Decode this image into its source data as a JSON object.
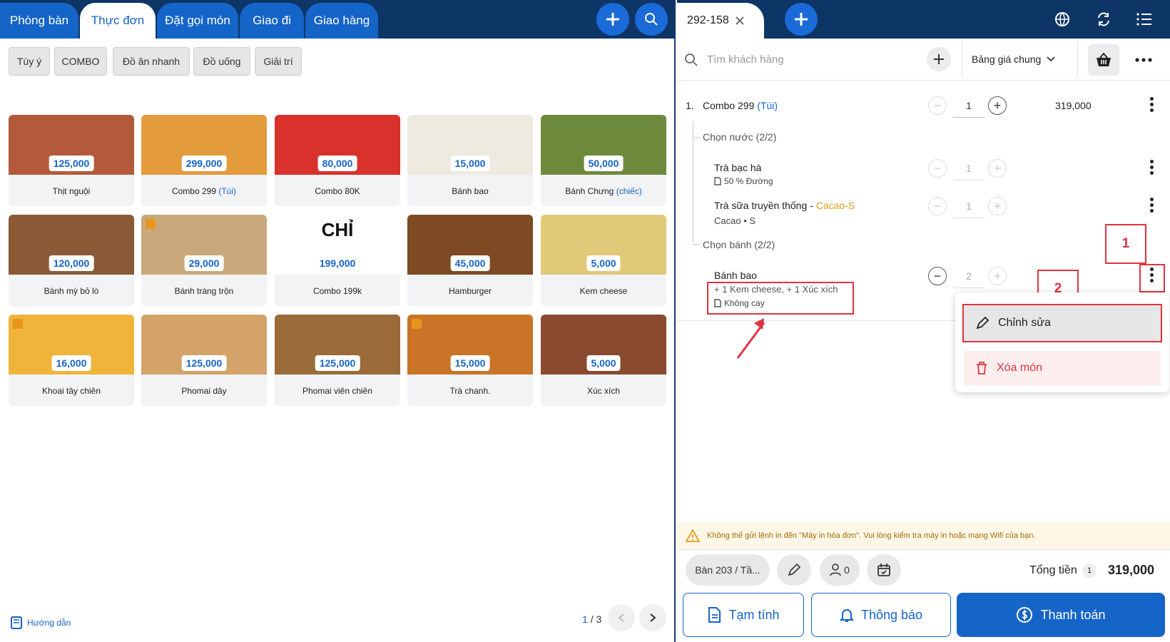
{
  "left": {
    "tabs": [
      "Phòng bàn",
      "Thực đơn",
      "Đặt gọi món",
      "Giao đi",
      "Giao hàng"
    ],
    "categories": [
      "Tùy ý",
      "COMBO",
      "Đồ ăn nhanh",
      "Đồ uống",
      "Giải trí"
    ],
    "products": [
      {
        "price": "125,000",
        "name": "Thịt nguội",
        "suffix": "",
        "color": "#b35a3c"
      },
      {
        "price": "299,000",
        "name": "Combo 299",
        "suffix": "(Túi)",
        "color": "#e39b3b"
      },
      {
        "price": "80,000",
        "name": "Combo 80K",
        "suffix": "",
        "color": "#d9312b"
      },
      {
        "price": "15,000",
        "name": "Bánh bao",
        "suffix": "",
        "color": "#eeeae0"
      },
      {
        "price": "50,000",
        "name": "Bánh Chưng",
        "suffix": "(chiếc)",
        "color": "#6d8a3c"
      },
      {
        "price": "120,000",
        "name": "Bánh mỳ bỏ lò",
        "suffix": "",
        "color": "#8a5a36"
      },
      {
        "price": "29,000",
        "name": "Bánh tráng trộn",
        "suffix": "",
        "color": "#c9a97b"
      },
      {
        "price": "199,000",
        "name": "Combo 199k",
        "suffix": "",
        "color": "#ffffff"
      },
      {
        "price": "45,000",
        "name": "Hamburger",
        "suffix": "",
        "color": "#7d4a23"
      },
      {
        "price": "5,000",
        "name": "Kem cheese",
        "suffix": "",
        "color": "#e1c97a"
      },
      {
        "price": "16,000",
        "name": "Khoai tây chiên",
        "suffix": "",
        "color": "#f0b43a"
      },
      {
        "price": "125,000",
        "name": "Phomai dây",
        "suffix": "",
        "color": "#d3a36a"
      },
      {
        "price": "125,000",
        "name": "Phomai viên chiên",
        "suffix": "",
        "color": "#9a6a38"
      },
      {
        "price": "15,000",
        "name": "Trà chanh.",
        "suffix": "",
        "color": "#c97426"
      },
      {
        "price": "5,000",
        "name": "Xúc xích",
        "suffix": "",
        "color": "#8a4a30"
      }
    ],
    "combo_promo": "CHỈ",
    "guide": "Hướng dẫn",
    "pagination": {
      "current": "1",
      "total": "/ 3"
    }
  },
  "right": {
    "order_tab": "292-158",
    "search_placeholder": "Tìm khách hàng",
    "price_list": "Bảng giá chung",
    "line1": {
      "index": "1.",
      "name": "Combo 299",
      "unit": "(Túi)",
      "qty": "1",
      "total": "319,000"
    },
    "group1": "Chọn nước (2/2)",
    "item_a": {
      "name": "Trà bạc hà",
      "note": "50 % Đường",
      "qty": "1"
    },
    "item_b": {
      "name": "Trà sữa truyền thống",
      "sep": " - ",
      "variant": "Cacao-S",
      "detail": "Cacao • S",
      "qty": "1"
    },
    "group2": "Chọn bánh (2/2)",
    "item_c": {
      "name": "Bánh bao",
      "addons": "+ 1 Kem cheese, + 1 Xúc xích",
      "note": "Không cay",
      "qty": "2"
    },
    "menu": {
      "edit": "Chỉnh sửa",
      "delete": "Xóa món"
    },
    "annotations": {
      "one": "1",
      "two": "2"
    },
    "warning": "Không thể gửi lệnh in đến \"Máy in hóa đơn\". Vui lòng kiểm tra máy in hoặc mạng Wifi của bạn.",
    "table_pill": "Bàn 203 / Tầ...",
    "guests": "0",
    "total_label": "Tổng tiền",
    "total_count": "1",
    "total_value": "319,000",
    "btn_temp": "Tạm tính",
    "btn_notify": "Thông báo",
    "btn_pay": "Thanh toán"
  },
  "colors": {
    "brand": "#1564c8",
    "navy": "#0d3566",
    "warn": "#e39a1a",
    "red": "#e0333f"
  }
}
